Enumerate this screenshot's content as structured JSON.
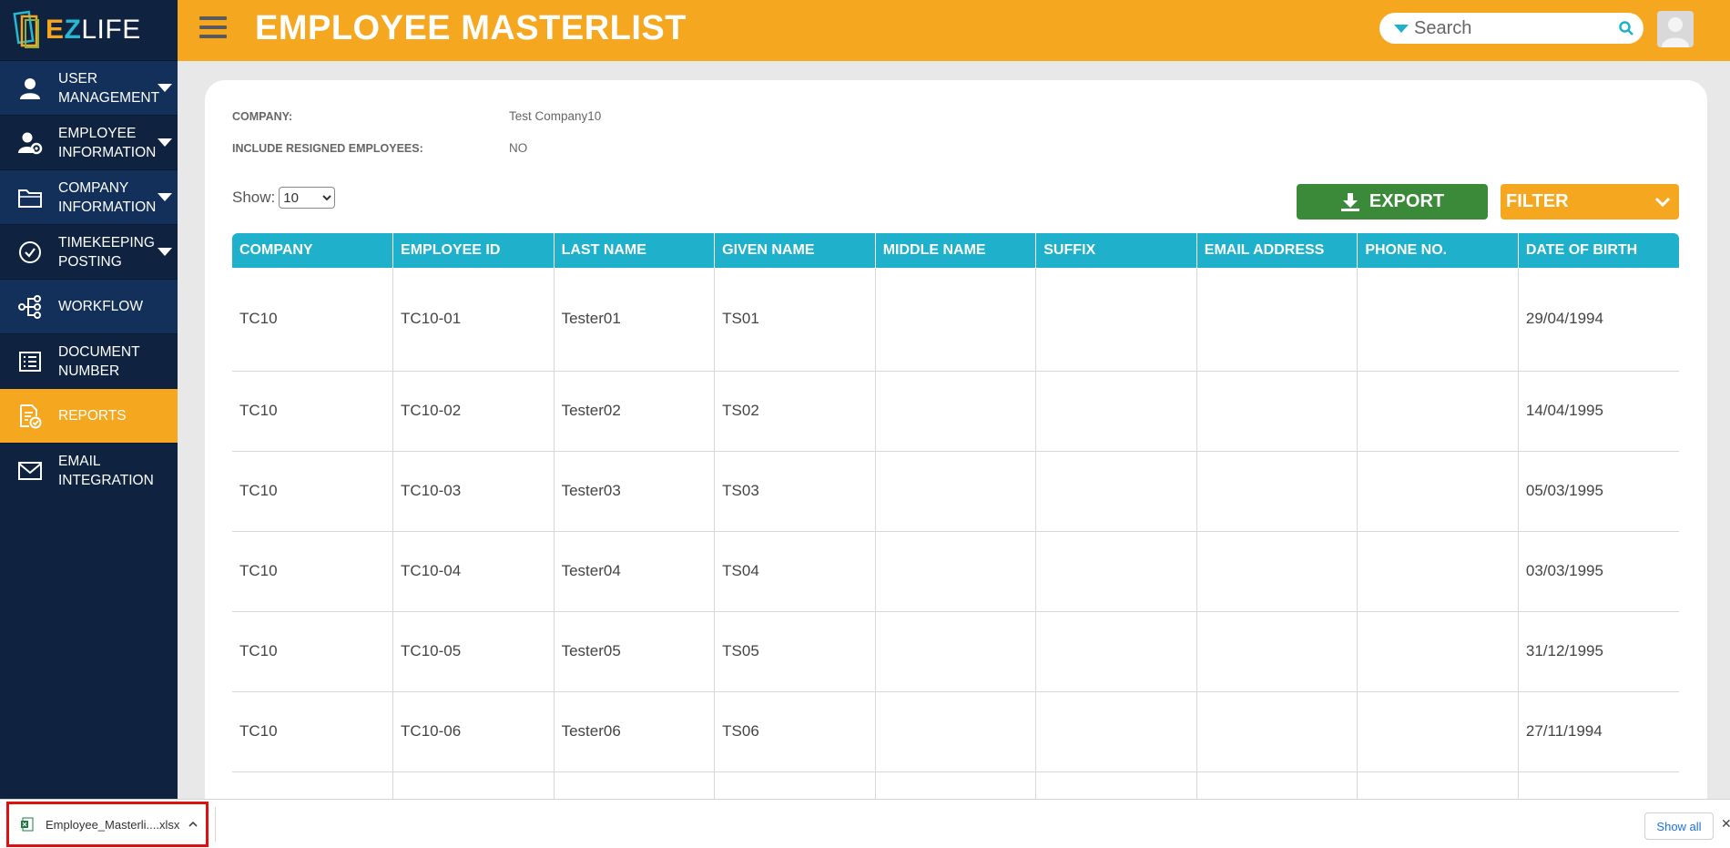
{
  "app": {
    "logo_letters": [
      "E",
      "Z",
      "LIFE"
    ]
  },
  "sidebar": {
    "items": [
      {
        "label_line1": "USER",
        "label_line2": "MANAGEMENT",
        "icon": "user-icon",
        "has_caret": true
      },
      {
        "label_line1": "EMPLOYEE",
        "label_line2": "INFORMATION",
        "icon": "user-gear-icon",
        "has_caret": true
      },
      {
        "label_line1": "COMPANY",
        "label_line2": "INFORMATION",
        "icon": "folder-icon",
        "has_caret": true
      },
      {
        "label_line1": "TIMEKEEPING",
        "label_line2": "POSTING",
        "icon": "check-circle-icon",
        "has_caret": true
      },
      {
        "label_line1": "WORKFLOW",
        "label_line2": "",
        "icon": "workflow-icon",
        "has_caret": false
      },
      {
        "label_line1": "DOCUMENT",
        "label_line2": "NUMBER",
        "icon": "document-list-icon",
        "has_caret": false
      },
      {
        "label_line1": "REPORTS",
        "label_line2": "",
        "icon": "report-check-icon",
        "has_caret": false,
        "active": true
      },
      {
        "label_line1": "EMAIL",
        "label_line2": "INTEGRATION",
        "icon": "envelope-icon",
        "has_caret": false
      }
    ]
  },
  "header": {
    "title": "EMPLOYEE MASTERLIST",
    "search_placeholder": "Search"
  },
  "filters": {
    "company_label": "COMPANY:",
    "company_value": "Test Company10",
    "resigned_label": "INCLUDE RESIGNED EMPLOYEES:",
    "resigned_value": "NO"
  },
  "controls": {
    "show_label": "Show:",
    "show_value": "10",
    "export_label": "EXPORT",
    "filter_label": "FILTER"
  },
  "table": {
    "columns": [
      "COMPANY",
      "EMPLOYEE ID",
      "LAST NAME",
      "GIVEN NAME",
      "MIDDLE NAME",
      "SUFFIX",
      "EMAIL ADDRESS",
      "PHONE NO.",
      "DATE OF BIRTH"
    ],
    "rows": [
      [
        "TC10",
        "TC10-01",
        "Tester01",
        "TS01",
        "",
        "",
        "",
        "",
        "29/04/1994"
      ],
      [
        "TC10",
        "TC10-02",
        "Tester02",
        "TS02",
        "",
        "",
        "",
        "",
        "14/04/1995"
      ],
      [
        "TC10",
        "TC10-03",
        "Tester03",
        "TS03",
        "",
        "",
        "",
        "",
        "05/03/1995"
      ],
      [
        "TC10",
        "TC10-04",
        "Tester04",
        "TS04",
        "",
        "",
        "",
        "",
        "03/03/1995"
      ],
      [
        "TC10",
        "TC10-05",
        "Tester05",
        "TS05",
        "",
        "",
        "",
        "",
        "31/12/1995"
      ],
      [
        "TC10",
        "TC10-06",
        "Tester06",
        "TS06",
        "",
        "",
        "",
        "",
        "27/11/1994"
      ],
      [
        "",
        "",
        "",
        "",
        "",
        "",
        "",
        "",
        ""
      ]
    ]
  },
  "download_bar": {
    "file_name": "Employee_Masterli....xlsx",
    "show_all": "Show all",
    "close": "✕"
  },
  "colors": {
    "sidebar_bg": "#0f2340",
    "accent_orange": "#f5a81f",
    "table_header": "#1fb0cc",
    "export_green": "#3a8a3a"
  }
}
